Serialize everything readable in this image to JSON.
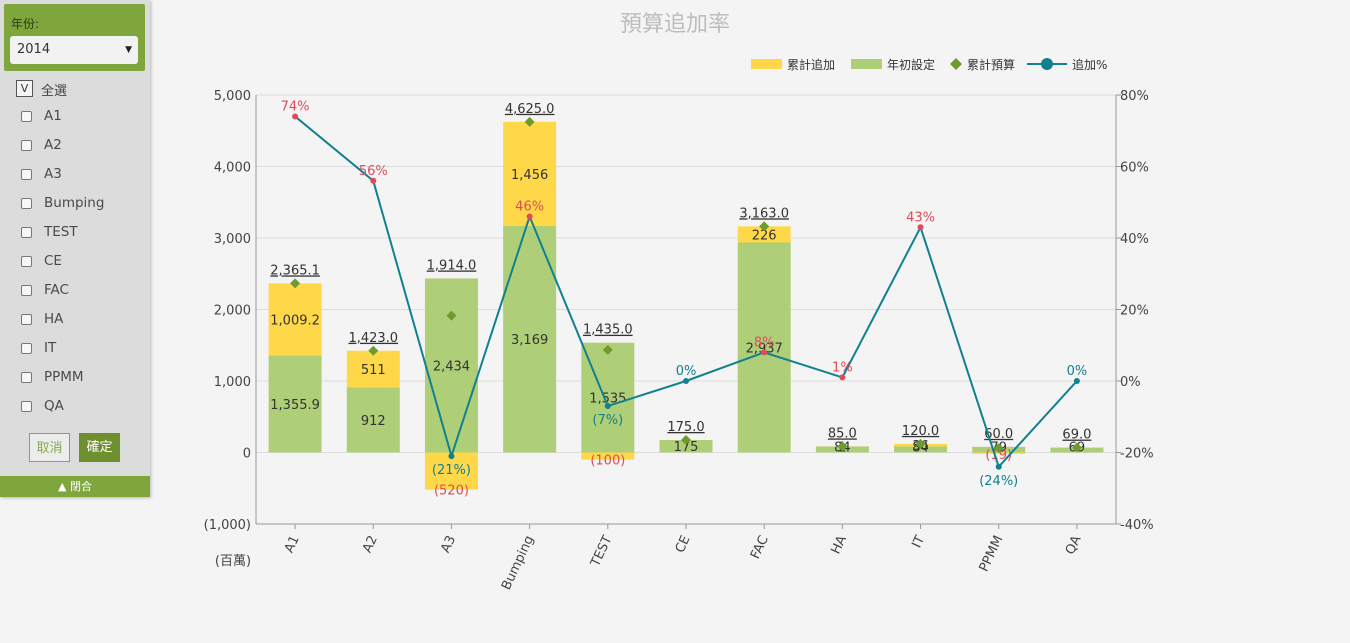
{
  "filter": {
    "year_label": "年份:",
    "year_value": "2014",
    "select_all_mark": "V",
    "select_all_label": "全選",
    "items": [
      "A1",
      "A2",
      "A3",
      "Bumping",
      "TEST",
      "CE",
      "FAC",
      "HA",
      "IT",
      "PPMM",
      "QA"
    ],
    "cancel_label": "取消",
    "confirm_label": "確定",
    "collapse_label": "▲ 閉合"
  },
  "colors": {
    "cumulative_add": "#ffd84a",
    "initial": "#aecf78",
    "cumulative_budget": "#6f9a2e",
    "add_pct": "#11808f",
    "pct_positive": "#e04b5a",
    "pct_negative": "#11808f",
    "grid": "#dddddd"
  },
  "chart_data": {
    "type": "bar",
    "title": "預算追加率",
    "categories": [
      "A1",
      "A2",
      "A3",
      "Bumping",
      "TEST",
      "CE",
      "FAC",
      "HA",
      "IT",
      "PPMM",
      "QA"
    ],
    "y_unit_label": "(百萬)",
    "ylim": [
      -1000,
      5000
    ],
    "yticks": [
      "(1,000)",
      "0",
      "1,000",
      "2,000",
      "3,000",
      "4,000",
      "5,000"
    ],
    "y2lim": [
      -40,
      80
    ],
    "y2ticks": [
      "-40%",
      "-20%",
      "0%",
      "20%",
      "40%",
      "60%",
      "80%"
    ],
    "legend_position": "top-right",
    "series": [
      {
        "name": "累計追加",
        "type": "bar-stacked",
        "values": [
          1009.2,
          511,
          -520,
          1456,
          -100,
          0,
          226,
          1,
          36,
          -19,
          0
        ],
        "labels": [
          "1,009.2",
          "511",
          "(520)",
          "1,456",
          "(100)",
          "",
          "226",
          "1",
          "36",
          "(19)",
          ""
        ]
      },
      {
        "name": "年初設定",
        "type": "bar-stacked",
        "values": [
          1355.9,
          912,
          2434,
          3169,
          1535,
          175,
          2937,
          84,
          84,
          79,
          69
        ],
        "labels": [
          "1,355.9",
          "912",
          "2,434",
          "3,169",
          "1,535",
          "175",
          "2,937",
          "84",
          "84",
          "79",
          "69"
        ]
      },
      {
        "name": "累計預算",
        "type": "diamond",
        "values": [
          2365.1,
          1423.0,
          1914.0,
          4625.0,
          1435.0,
          175.0,
          3163.0,
          85.0,
          120.0,
          60.0,
          69.0
        ],
        "labels": [
          "2,365.1",
          "1,423.0",
          "1,914.0",
          "4,625.0",
          "1,435.0",
          "175.0",
          "3,163.0",
          "85.0",
          "120.0",
          "60.0",
          "69.0"
        ]
      },
      {
        "name": "追加%",
        "type": "line",
        "axis": "right",
        "values": [
          74,
          56,
          -21,
          46,
          -7,
          0,
          8,
          1,
          43,
          -24,
          0
        ],
        "labels": [
          "74%",
          "56%",
          "(21%)",
          "46%",
          "(7%)",
          "0%",
          "8%",
          "1%",
          "43%",
          "(24%)",
          "0%"
        ]
      }
    ]
  }
}
